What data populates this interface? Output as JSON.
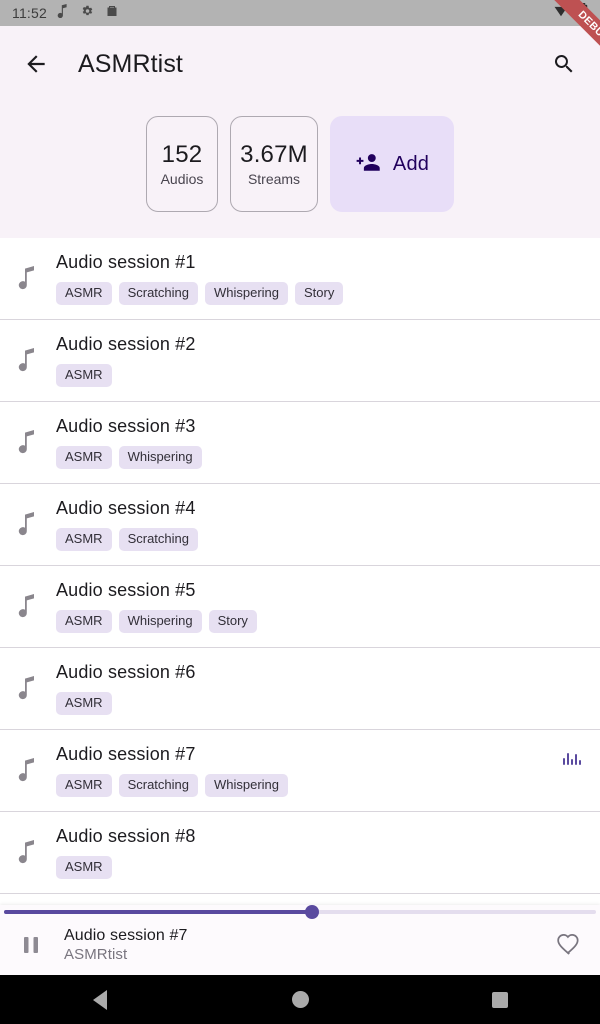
{
  "status_bar": {
    "time": "11:52",
    "icons": [
      "music-note-icon",
      "gear-icon",
      "bag-icon"
    ],
    "right_icons": [
      "wifi-icon",
      "battery-icon"
    ]
  },
  "debug_banner": {
    "label": "DEBUG",
    "color": "#BE5152"
  },
  "app_bar": {
    "back_icon": "arrow-left-icon",
    "title": "ASMRtist",
    "search_icon": "search-icon"
  },
  "header": {
    "stats": [
      {
        "value": "152",
        "label": "Audios"
      },
      {
        "value": "3.67M",
        "label": "Streams"
      }
    ],
    "add_button": {
      "label": "Add",
      "icon": "person-add-icon",
      "bg": "#E8DEF8",
      "fg": "#21005D"
    }
  },
  "list": {
    "items": [
      {
        "title": "Audio session #1",
        "tags": [
          "ASMR",
          "Scratching",
          "Whispering",
          "Story"
        ],
        "playing": false
      },
      {
        "title": "Audio session #2",
        "tags": [
          "ASMR"
        ],
        "playing": false
      },
      {
        "title": "Audio session #3",
        "tags": [
          "ASMR",
          "Whispering"
        ],
        "playing": false
      },
      {
        "title": "Audio session #4",
        "tags": [
          "ASMR",
          "Scratching"
        ],
        "playing": false
      },
      {
        "title": "Audio session #5",
        "tags": [
          "ASMR",
          "Whispering",
          "Story"
        ],
        "playing": false
      },
      {
        "title": "Audio session #6",
        "tags": [
          "ASMR"
        ],
        "playing": false
      },
      {
        "title": "Audio session #7",
        "tags": [
          "ASMR",
          "Scratching",
          "Whispering"
        ],
        "playing": true
      },
      {
        "title": "Audio session #8",
        "tags": [
          "ASMR"
        ],
        "playing": false
      }
    ]
  },
  "player": {
    "title": "Audio session #7",
    "artist": "ASMRtist",
    "play_state_icon": "pause-icon",
    "favorite_icon": "heart-outline-icon",
    "progress_percent": 52,
    "accent_color": "#5A4A9F"
  },
  "nav_bar": {
    "back": "nav-back-triangle-icon",
    "home": "nav-home-circle-icon",
    "recents": "nav-recents-square-icon"
  }
}
